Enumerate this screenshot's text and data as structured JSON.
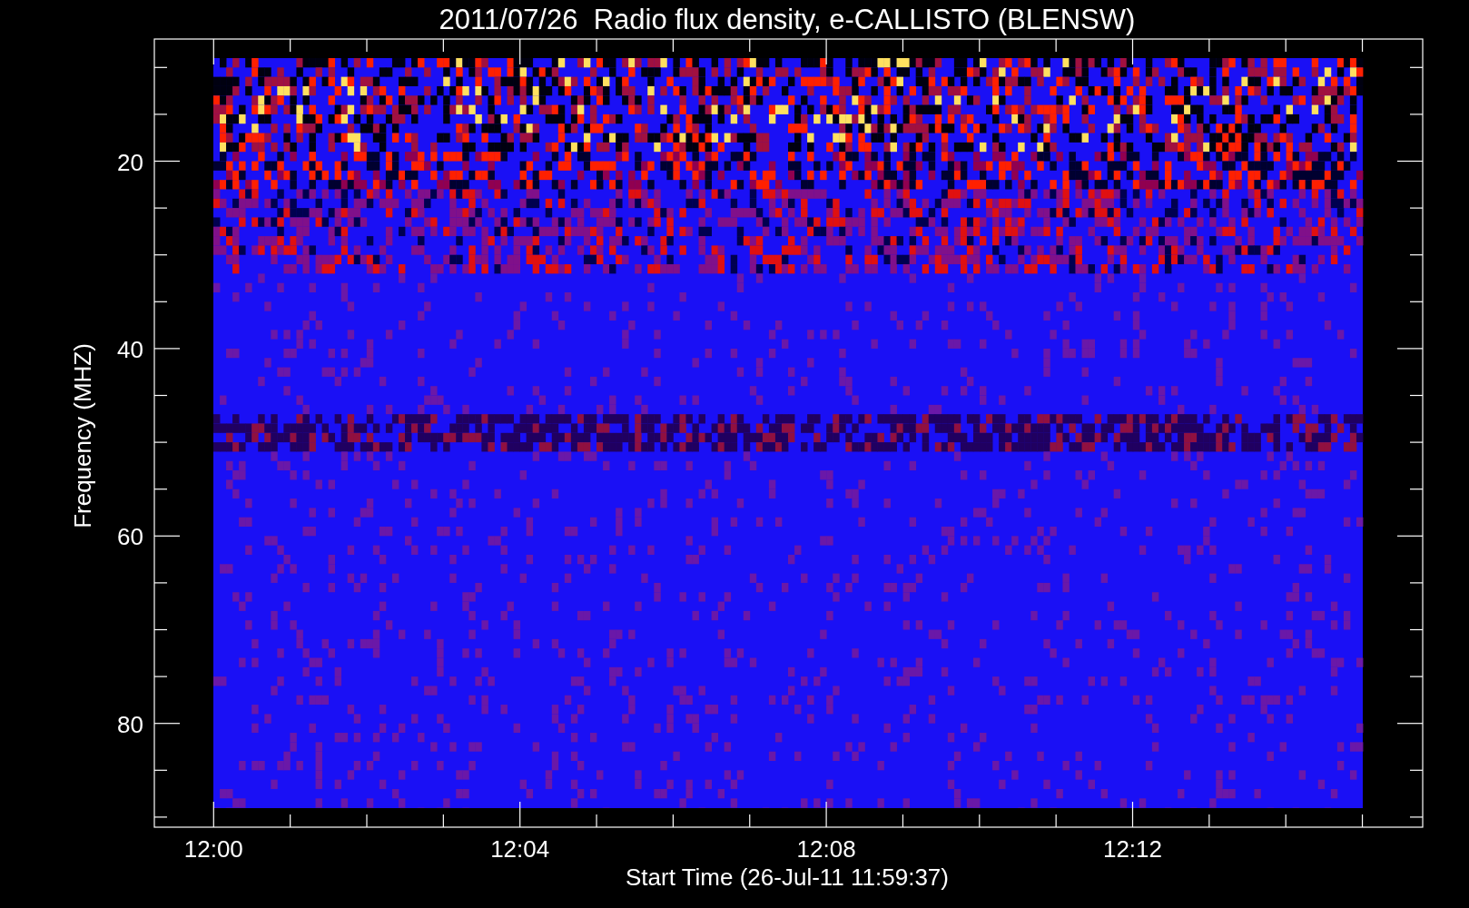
{
  "title": "2011/07/26  Radio flux density, e-CALLISTO (BLENSW)",
  "y_axis": {
    "label": "Frequency (MHZ)",
    "ticks": [
      "20",
      "40",
      "60",
      "80"
    ]
  },
  "x_axis": {
    "label": "Start Time (26-Jul-11 11:59:37)",
    "ticks": [
      "12:00",
      "12:04",
      "12:08",
      "12:12"
    ]
  }
}
